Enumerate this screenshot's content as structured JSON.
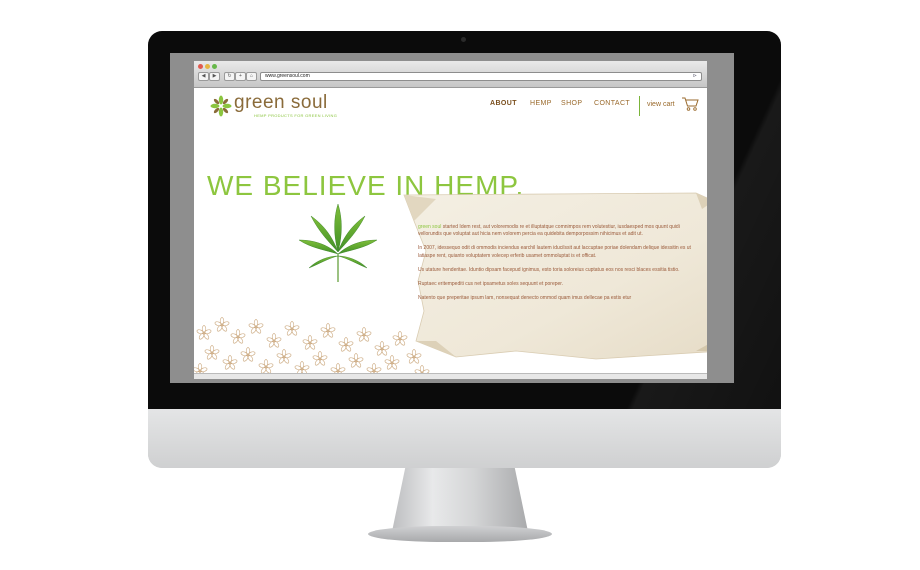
{
  "browser": {
    "url": "www.greensoul.com"
  },
  "site": {
    "logo_name": "green soul",
    "tagline": "HEMP PRODUCTS FOR GREEN LIVING",
    "nav": [
      {
        "label": "ABOUT",
        "active": true
      },
      {
        "label": "HEMP",
        "active": false
      },
      {
        "label": "SHOP",
        "active": false
      },
      {
        "label": "CONTACT",
        "active": false
      }
    ],
    "cart_label": "view cart",
    "headline": "WE BELIEVE IN HEMP.",
    "body": {
      "brand": "green soul",
      "p1_rest": " started Idem rest, aut voloremodis re et illuptatque comnimpos rem volutestiur, iusdaesped mos quunt quidi vellorundis que voluptat aut hicia nem volorem percia ea quidebita demporpossim nihicimus et adit ut.",
      "p2": "In 2007, idessequo odit di ommodis inciendus earchil lautem iducilssit aut laccuptae poriae dolendam delique idessitin es ut latiaspe rent, quianto voluptatem volecep erferib usamet ommoluptat is et officat.",
      "p3": "Us utature henderitae. Iduntio dipsam facepud ignimus, esto toria soloreius cuptatus eos nos resci blaces essitia tistio.",
      "p4": "Ruptaec eritempediti cus net ipsametus soles sequunt et poreper.",
      "p5": "Natento que preperitae ipsum lam, nonsequat denecto ommod quam imus dellecae pa estis etur"
    }
  },
  "colors": {
    "green": "#8dc63f",
    "brown": "#9a6a2c",
    "body_text": "#9a5a3a",
    "screen_gray": "#8e8e8e"
  },
  "icons": [
    "leaf-logo-icon",
    "cart-icon",
    "hemp-leaf-icon",
    "back-icon",
    "forward-icon",
    "reload-icon",
    "home-icon",
    "rss-icon"
  ]
}
